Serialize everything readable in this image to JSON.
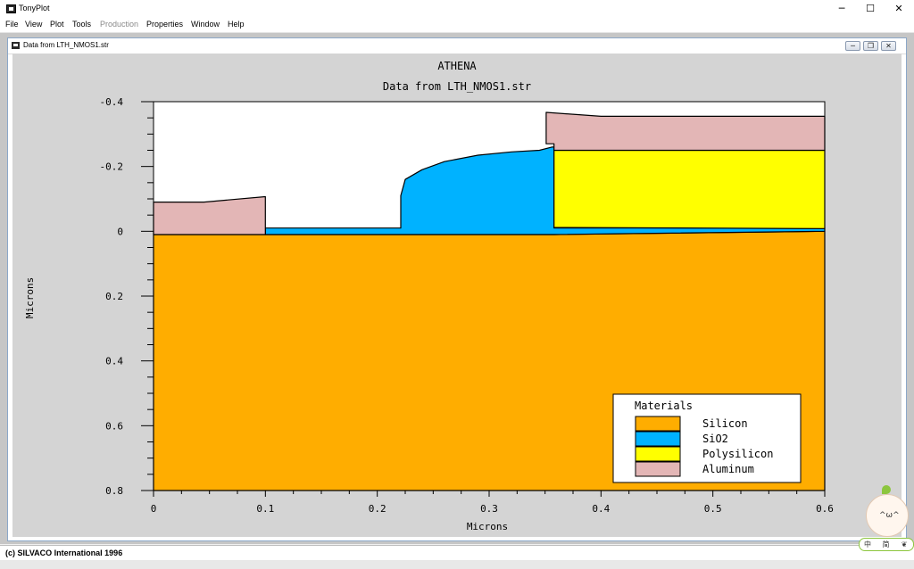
{
  "window": {
    "app_title": "TonyPlot",
    "min_glyph": "─",
    "max_glyph": "☐",
    "close_glyph": "✕"
  },
  "menu": [
    {
      "label": "File",
      "enabled": true
    },
    {
      "label": "View",
      "enabled": true
    },
    {
      "label": "Plot",
      "enabled": true
    },
    {
      "label": "Tools",
      "enabled": true
    },
    {
      "label": "Production",
      "enabled": false
    },
    {
      "label": "Properties",
      "enabled": true
    },
    {
      "label": "Window",
      "enabled": true
    },
    {
      "label": "Help",
      "enabled": true
    }
  ],
  "inner_window": {
    "title": "Data from LTH_NMOS1.str"
  },
  "plot": {
    "title": "ATHENA",
    "subtitle": "Data from LTH_NMOS1.str",
    "xlabel": "Microns",
    "ylabel": "Microns",
    "xticks": [
      "0",
      "0.1",
      "0.2",
      "0.3",
      "0.4",
      "0.5",
      "0.6"
    ],
    "yticks": [
      "-0.4",
      "-0.2",
      "0",
      "0.2",
      "0.4",
      "0.6",
      "0.8"
    ]
  },
  "chart_data": {
    "type": "area",
    "title": "ATHENA",
    "subtitle": "Data from LTH_NMOS1.str",
    "xlabel": "Microns",
    "ylabel": "Microns",
    "xlim": [
      0,
      0.6
    ],
    "ylim": [
      -0.4,
      0.8
    ],
    "y_inverted": true,
    "legend_title": "Materials",
    "legend_position": "bottom-right",
    "materials": [
      {
        "name": "Silicon",
        "color": "#ffad00"
      },
      {
        "name": "SiO2",
        "color": "#00b2ff"
      },
      {
        "name": "Polysilicon",
        "color": "#ffff00"
      },
      {
        "name": "Aluminum",
        "color": "#e3b6b6"
      }
    ],
    "regions": [
      {
        "material": "Silicon",
        "points": [
          [
            0,
            0.01
          ],
          [
            0.1,
            0.01
          ],
          [
            0.2,
            0.01
          ],
          [
            0.3,
            0.01
          ],
          [
            0.358,
            0.01
          ],
          [
            0.6,
            0.0
          ],
          [
            0.6,
            0.8
          ],
          [
            0,
            0.8
          ]
        ]
      },
      {
        "material": "SiO2",
        "points": [
          [
            0.1,
            0.01
          ],
          [
            0.1,
            -0.01
          ],
          [
            0.221,
            -0.01
          ],
          [
            0.221,
            -0.11
          ],
          [
            0.225,
            -0.16
          ],
          [
            0.24,
            -0.19
          ],
          [
            0.26,
            -0.215
          ],
          [
            0.29,
            -0.235
          ],
          [
            0.32,
            -0.245
          ],
          [
            0.345,
            -0.25
          ],
          [
            0.356,
            -0.26
          ],
          [
            0.358,
            -0.26
          ],
          [
            0.358,
            -0.01
          ],
          [
            0.6,
            -0.01
          ],
          [
            0.6,
            0.0
          ],
          [
            0.358,
            0.01
          ],
          [
            0.1,
            0.01
          ]
        ]
      },
      {
        "material": "Polysilicon",
        "points": [
          [
            0.358,
            -0.012
          ],
          [
            0.358,
            -0.25
          ],
          [
            0.6,
            -0.25
          ],
          [
            0.6,
            -0.008
          ]
        ]
      },
      {
        "material": "Aluminum",
        "points": [
          [
            0,
            0.01
          ],
          [
            0,
            -0.09
          ],
          [
            0.045,
            -0.09
          ],
          [
            0.1,
            -0.107
          ],
          [
            0.1,
            0.01
          ]
        ]
      },
      {
        "material": "Aluminum",
        "points": [
          [
            0.351,
            -0.27
          ],
          [
            0.351,
            -0.367
          ],
          [
            0.4,
            -0.355
          ],
          [
            0.6,
            -0.355
          ],
          [
            0.6,
            -0.25
          ],
          [
            0.358,
            -0.25
          ],
          [
            0.358,
            -0.27
          ]
        ]
      }
    ]
  },
  "status": {
    "text": "(c) SILVACO International 1996"
  },
  "ime": {
    "face_glyph": "^ω^",
    "items": [
      "中",
      "简",
      "❦"
    ]
  },
  "colors": {
    "window_border": "#8ca8c8",
    "panel_bg": "#d4d4d4",
    "plot_bg": "#ffffff"
  }
}
